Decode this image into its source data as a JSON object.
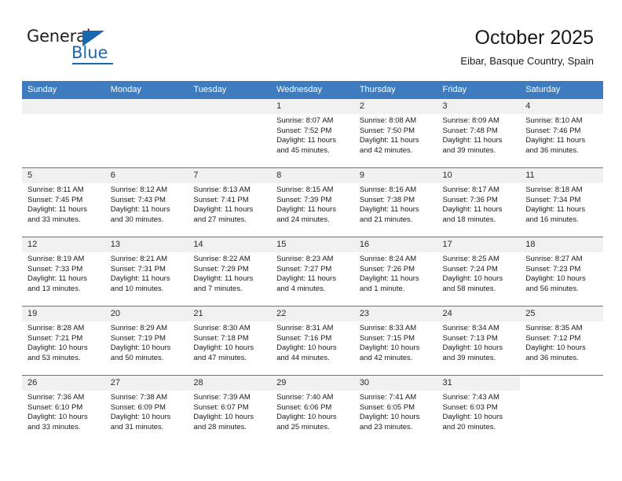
{
  "logo": {
    "word_top": "General",
    "word_bottom": "Blue",
    "accent_color": "#1a69b0",
    "triangle_icon": "triangle-icon"
  },
  "header": {
    "title": "October 2025",
    "subtitle": "Eibar, Basque Country, Spain"
  },
  "theme": {
    "header_bg": "#3f7cbf",
    "daynum_bg": "#f0f0f0",
    "text": "#1a1a1a"
  },
  "calendar": {
    "weekday_headers": [
      "Sunday",
      "Monday",
      "Tuesday",
      "Wednesday",
      "Thursday",
      "Friday",
      "Saturday"
    ],
    "labels": {
      "sunrise": "Sunrise:",
      "sunset": "Sunset:",
      "daylight": "Daylight:"
    },
    "weeks": [
      [
        {
          "day": "",
          "lines": []
        },
        {
          "day": "",
          "lines": []
        },
        {
          "day": "",
          "lines": []
        },
        {
          "day": "1",
          "lines": [
            "Sunrise: 8:07 AM",
            "Sunset: 7:52 PM",
            "Daylight: 11 hours and 45 minutes."
          ]
        },
        {
          "day": "2",
          "lines": [
            "Sunrise: 8:08 AM",
            "Sunset: 7:50 PM",
            "Daylight: 11 hours and 42 minutes."
          ]
        },
        {
          "day": "3",
          "lines": [
            "Sunrise: 8:09 AM",
            "Sunset: 7:48 PM",
            "Daylight: 11 hours and 39 minutes."
          ]
        },
        {
          "day": "4",
          "lines": [
            "Sunrise: 8:10 AM",
            "Sunset: 7:46 PM",
            "Daylight: 11 hours and 36 minutes."
          ]
        }
      ],
      [
        {
          "day": "5",
          "lines": [
            "Sunrise: 8:11 AM",
            "Sunset: 7:45 PM",
            "Daylight: 11 hours and 33 minutes."
          ]
        },
        {
          "day": "6",
          "lines": [
            "Sunrise: 8:12 AM",
            "Sunset: 7:43 PM",
            "Daylight: 11 hours and 30 minutes."
          ]
        },
        {
          "day": "7",
          "lines": [
            "Sunrise: 8:13 AM",
            "Sunset: 7:41 PM",
            "Daylight: 11 hours and 27 minutes."
          ]
        },
        {
          "day": "8",
          "lines": [
            "Sunrise: 8:15 AM",
            "Sunset: 7:39 PM",
            "Daylight: 11 hours and 24 minutes."
          ]
        },
        {
          "day": "9",
          "lines": [
            "Sunrise: 8:16 AM",
            "Sunset: 7:38 PM",
            "Daylight: 11 hours and 21 minutes."
          ]
        },
        {
          "day": "10",
          "lines": [
            "Sunrise: 8:17 AM",
            "Sunset: 7:36 PM",
            "Daylight: 11 hours and 18 minutes."
          ]
        },
        {
          "day": "11",
          "lines": [
            "Sunrise: 8:18 AM",
            "Sunset: 7:34 PM",
            "Daylight: 11 hours and 16 minutes."
          ]
        }
      ],
      [
        {
          "day": "12",
          "lines": [
            "Sunrise: 8:19 AM",
            "Sunset: 7:33 PM",
            "Daylight: 11 hours and 13 minutes."
          ]
        },
        {
          "day": "13",
          "lines": [
            "Sunrise: 8:21 AM",
            "Sunset: 7:31 PM",
            "Daylight: 11 hours and 10 minutes."
          ]
        },
        {
          "day": "14",
          "lines": [
            "Sunrise: 8:22 AM",
            "Sunset: 7:29 PM",
            "Daylight: 11 hours and 7 minutes."
          ]
        },
        {
          "day": "15",
          "lines": [
            "Sunrise: 8:23 AM",
            "Sunset: 7:27 PM",
            "Daylight: 11 hours and 4 minutes."
          ]
        },
        {
          "day": "16",
          "lines": [
            "Sunrise: 8:24 AM",
            "Sunset: 7:26 PM",
            "Daylight: 11 hours and 1 minute."
          ]
        },
        {
          "day": "17",
          "lines": [
            "Sunrise: 8:25 AM",
            "Sunset: 7:24 PM",
            "Daylight: 10 hours and 58 minutes."
          ]
        },
        {
          "day": "18",
          "lines": [
            "Sunrise: 8:27 AM",
            "Sunset: 7:23 PM",
            "Daylight: 10 hours and 56 minutes."
          ]
        }
      ],
      [
        {
          "day": "19",
          "lines": [
            "Sunrise: 8:28 AM",
            "Sunset: 7:21 PM",
            "Daylight: 10 hours and 53 minutes."
          ]
        },
        {
          "day": "20",
          "lines": [
            "Sunrise: 8:29 AM",
            "Sunset: 7:19 PM",
            "Daylight: 10 hours and 50 minutes."
          ]
        },
        {
          "day": "21",
          "lines": [
            "Sunrise: 8:30 AM",
            "Sunset: 7:18 PM",
            "Daylight: 10 hours and 47 minutes."
          ]
        },
        {
          "day": "22",
          "lines": [
            "Sunrise: 8:31 AM",
            "Sunset: 7:16 PM",
            "Daylight: 10 hours and 44 minutes."
          ]
        },
        {
          "day": "23",
          "lines": [
            "Sunrise: 8:33 AM",
            "Sunset: 7:15 PM",
            "Daylight: 10 hours and 42 minutes."
          ]
        },
        {
          "day": "24",
          "lines": [
            "Sunrise: 8:34 AM",
            "Sunset: 7:13 PM",
            "Daylight: 10 hours and 39 minutes."
          ]
        },
        {
          "day": "25",
          "lines": [
            "Sunrise: 8:35 AM",
            "Sunset: 7:12 PM",
            "Daylight: 10 hours and 36 minutes."
          ]
        }
      ],
      [
        {
          "day": "26",
          "lines": [
            "Sunrise: 7:36 AM",
            "Sunset: 6:10 PM",
            "Daylight: 10 hours and 33 minutes."
          ]
        },
        {
          "day": "27",
          "lines": [
            "Sunrise: 7:38 AM",
            "Sunset: 6:09 PM",
            "Daylight: 10 hours and 31 minutes."
          ]
        },
        {
          "day": "28",
          "lines": [
            "Sunrise: 7:39 AM",
            "Sunset: 6:07 PM",
            "Daylight: 10 hours and 28 minutes."
          ]
        },
        {
          "day": "29",
          "lines": [
            "Sunrise: 7:40 AM",
            "Sunset: 6:06 PM",
            "Daylight: 10 hours and 25 minutes."
          ]
        },
        {
          "day": "30",
          "lines": [
            "Sunrise: 7:41 AM",
            "Sunset: 6:05 PM",
            "Daylight: 10 hours and 23 minutes."
          ]
        },
        {
          "day": "31",
          "lines": [
            "Sunrise: 7:43 AM",
            "Sunset: 6:03 PM",
            "Daylight: 10 hours and 20 minutes."
          ]
        },
        {
          "day": "",
          "lines": []
        }
      ]
    ]
  }
}
